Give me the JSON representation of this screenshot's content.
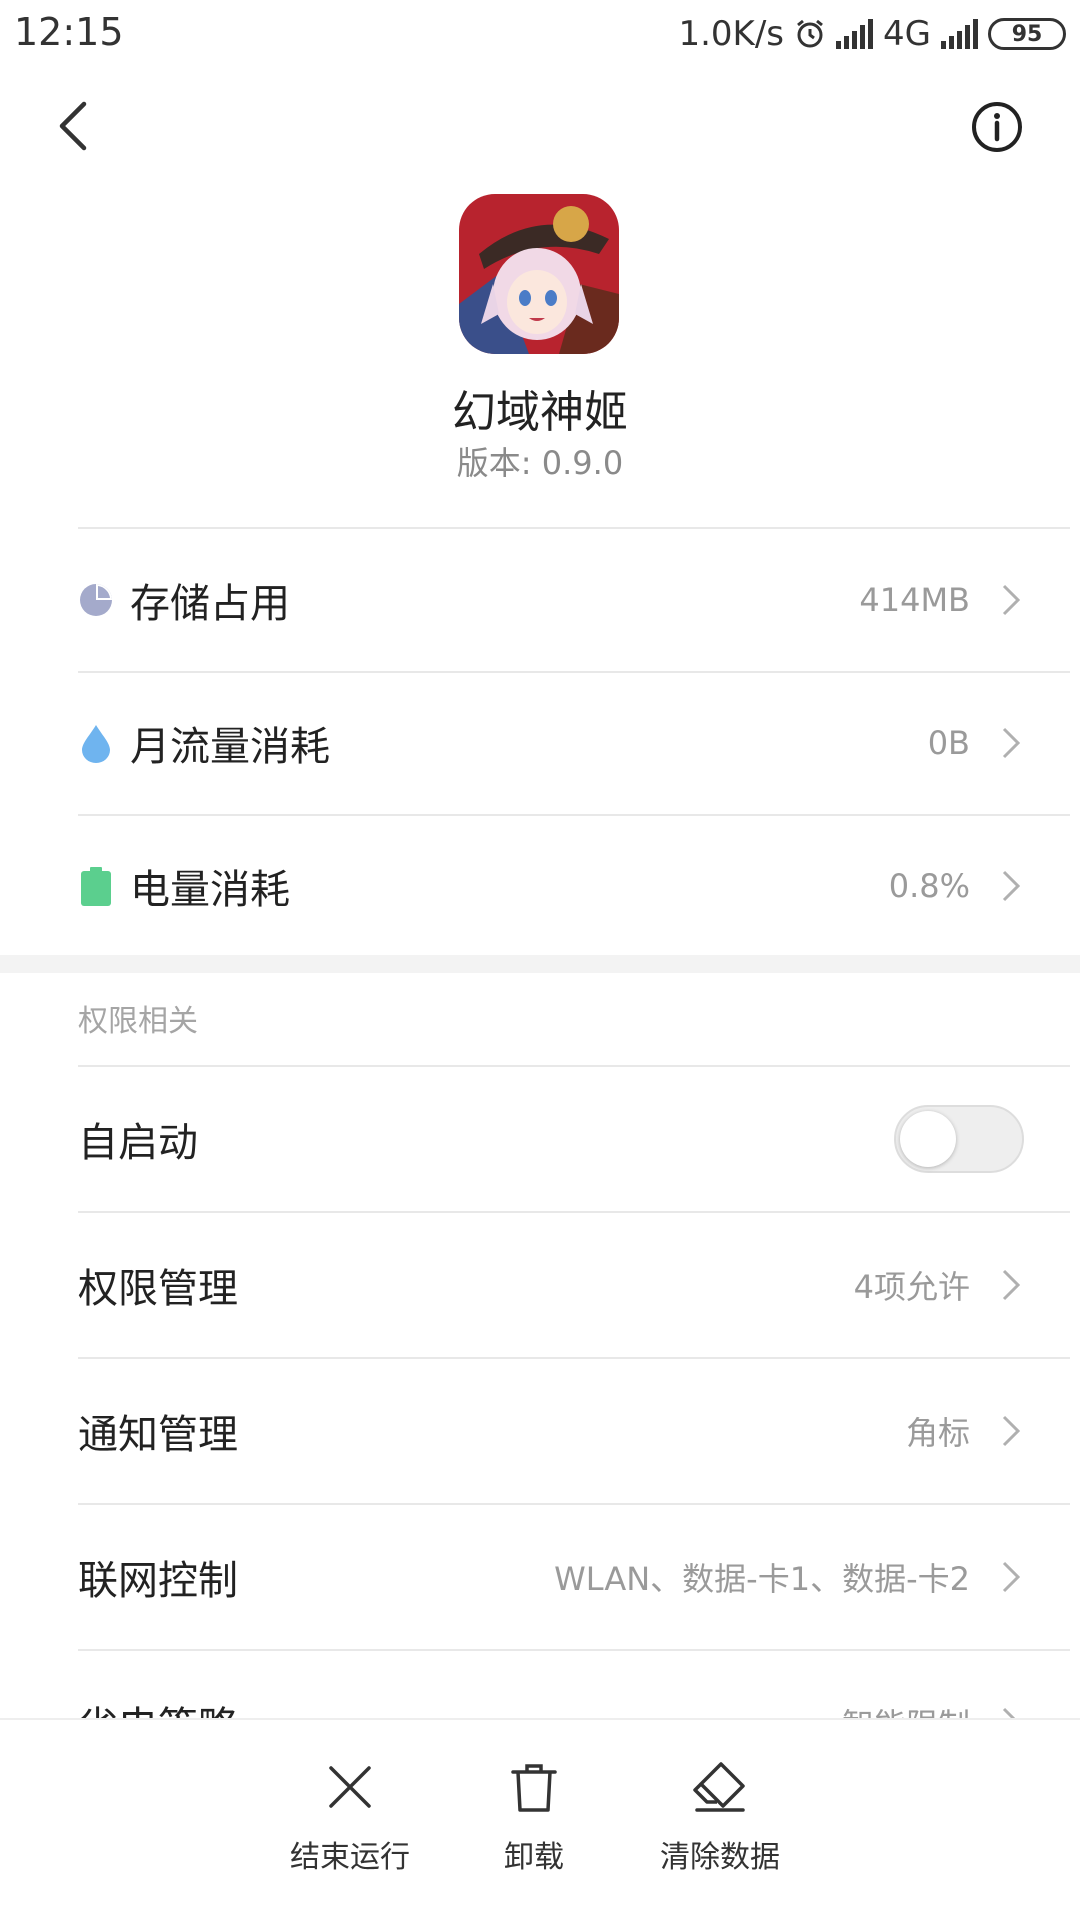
{
  "status_bar": {
    "time": "12:15",
    "net_speed": "1.0K/s",
    "network": "4G",
    "battery": "95"
  },
  "app": {
    "name": "幻域神姬",
    "version": "版本: 0.9.0"
  },
  "usage_rows": [
    {
      "label": "存储占用",
      "value": "414MB",
      "icon": "storage-pie-icon",
      "icon_color": "#a4aacb"
    },
    {
      "label": "月流量消耗",
      "value": "0B",
      "icon": "data-drop-icon",
      "icon_color": "#6fb4ef"
    },
    {
      "label": "电量消耗",
      "value": "0.8%",
      "icon": "battery-icon",
      "icon_color": "#5bcf8e"
    }
  ],
  "permissions_section": {
    "title": "权限相关",
    "autostart_label": "自启动",
    "autostart_enabled": false,
    "rows": [
      {
        "label": "权限管理",
        "value": "4项允许"
      },
      {
        "label": "通知管理",
        "value": "角标"
      },
      {
        "label": "联网控制",
        "value": "WLAN、数据-卡1、数据-卡2"
      },
      {
        "label": "省电策略",
        "value": "智能限制"
      }
    ]
  },
  "bottom_actions": [
    {
      "label": "结束运行",
      "icon": "close-x-icon"
    },
    {
      "label": "卸载",
      "icon": "trash-icon"
    },
    {
      "label": "清除数据",
      "icon": "eraser-icon"
    }
  ]
}
